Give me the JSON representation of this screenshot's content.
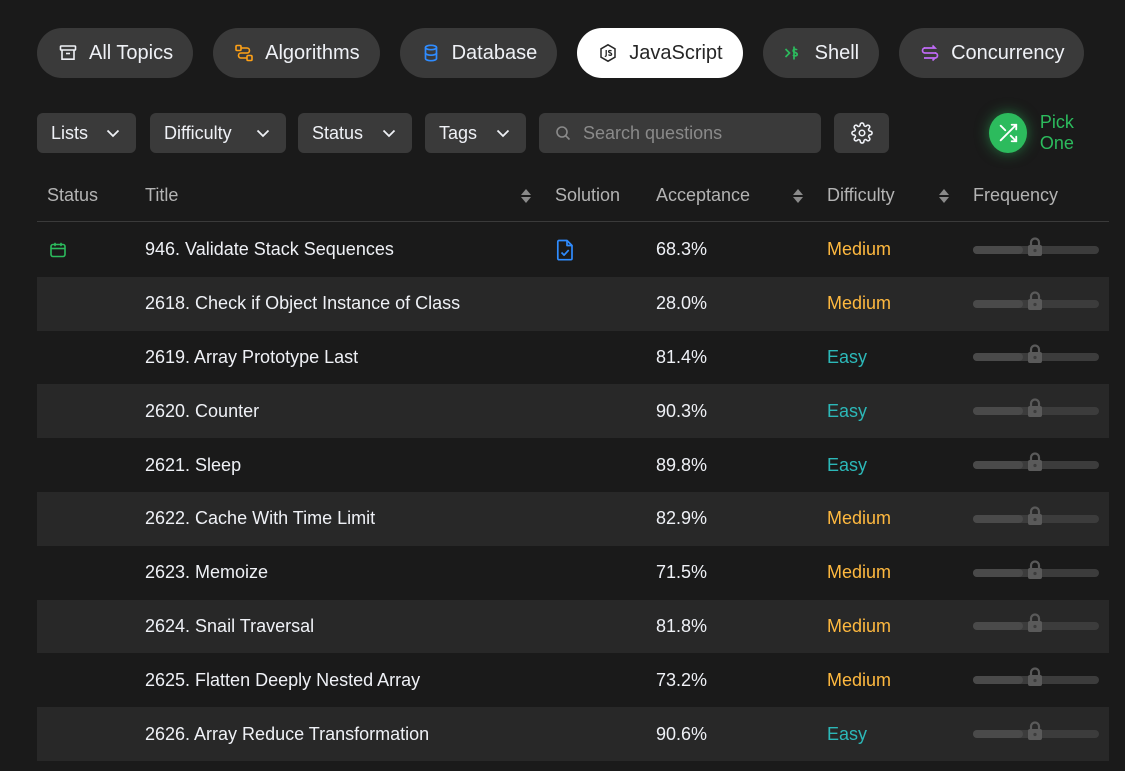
{
  "topics": [
    {
      "label": "All Topics",
      "icon": "archive-icon",
      "color": "#eff1f6",
      "active": false
    },
    {
      "label": "Algorithms",
      "icon": "algorithms-icon",
      "color": "#ffa116",
      "active": false
    },
    {
      "label": "Database",
      "icon": "database-icon",
      "color": "#2f8cff",
      "active": false
    },
    {
      "label": "JavaScript",
      "icon": "nodejs-icon",
      "color": "#262626",
      "active": true
    },
    {
      "label": "Shell",
      "icon": "shell-icon",
      "color": "#2cbb5d",
      "active": false
    },
    {
      "label": "Concurrency",
      "icon": "concurrency-icon",
      "color": "#c06af7",
      "active": false
    }
  ],
  "filters": {
    "lists": "Lists",
    "difficulty": "Difficulty",
    "status": "Status",
    "tags": "Tags",
    "search_placeholder": "Search questions",
    "pick_one": "Pick One"
  },
  "columns": {
    "status": "Status",
    "title": "Title",
    "solution": "Solution",
    "acceptance": "Acceptance",
    "difficulty": "Difficulty",
    "frequency": "Frequency"
  },
  "colors": {
    "easy": "#2cb8b8",
    "medium": "#ffb93f",
    "accent_green": "#2cbb5d",
    "solution_blue": "#2f8cff"
  },
  "rows": [
    {
      "title": "946. Validate Stack Sequences",
      "acceptance": "68.3%",
      "difficulty": "Medium",
      "status_icon": "calendar-icon",
      "has_solution": true,
      "frequency": 0.4
    },
    {
      "title": "2618. Check if Object Instance of Class",
      "acceptance": "28.0%",
      "difficulty": "Medium",
      "status_icon": "",
      "has_solution": false,
      "frequency": 0.4
    },
    {
      "title": "2619. Array Prototype Last",
      "acceptance": "81.4%",
      "difficulty": "Easy",
      "status_icon": "",
      "has_solution": false,
      "frequency": 0.4
    },
    {
      "title": "2620. Counter",
      "acceptance": "90.3%",
      "difficulty": "Easy",
      "status_icon": "",
      "has_solution": false,
      "frequency": 0.4
    },
    {
      "title": "2621. Sleep",
      "acceptance": "89.8%",
      "difficulty": "Easy",
      "status_icon": "",
      "has_solution": false,
      "frequency": 0.4
    },
    {
      "title": "2622. Cache With Time Limit",
      "acceptance": "82.9%",
      "difficulty": "Medium",
      "status_icon": "",
      "has_solution": false,
      "frequency": 0.4
    },
    {
      "title": "2623. Memoize",
      "acceptance": "71.5%",
      "difficulty": "Medium",
      "status_icon": "",
      "has_solution": false,
      "frequency": 0.4
    },
    {
      "title": "2624. Snail Traversal",
      "acceptance": "81.8%",
      "difficulty": "Medium",
      "status_icon": "",
      "has_solution": false,
      "frequency": 0.4
    },
    {
      "title": "2625. Flatten Deeply Nested Array",
      "acceptance": "73.2%",
      "difficulty": "Medium",
      "status_icon": "",
      "has_solution": false,
      "frequency": 0.4
    },
    {
      "title": "2626. Array Reduce Transformation",
      "acceptance": "90.6%",
      "difficulty": "Easy",
      "status_icon": "",
      "has_solution": false,
      "frequency": 0.4
    }
  ]
}
